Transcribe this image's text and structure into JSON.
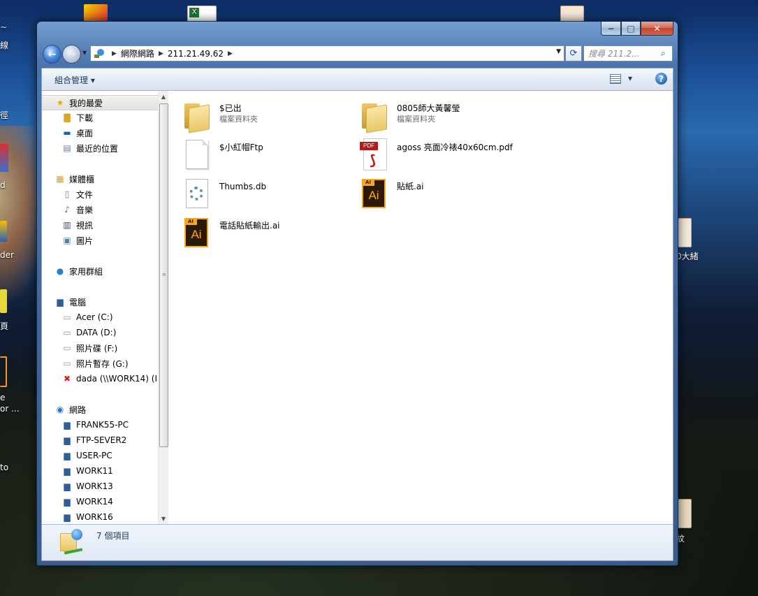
{
  "desktop": {
    "icons": [
      {
        "label": "線"
      },
      {
        "label": "徑"
      },
      {
        "label": "d"
      },
      {
        "label": "der"
      },
      {
        "label": "頁"
      },
      {
        "label": "e"
      },
      {
        "label": "or ..."
      },
      {
        "label": "to"
      },
      {
        "label": "0大緒"
      },
      {
        "label": "紋"
      }
    ]
  },
  "window": {
    "caption_buttons": {
      "minimize": "−",
      "maximize": "□",
      "close": "✕"
    },
    "address": {
      "crumbs": [
        "網際網路",
        "211.21.49.62"
      ]
    },
    "search": {
      "placeholder": "搜尋 211.2..."
    },
    "toolbar": {
      "organize": "組合管理 ▾",
      "views": "▾",
      "help": "?"
    },
    "sidebar": {
      "favorites": {
        "title": "我的最愛",
        "items": [
          "下載",
          "桌面",
          "最近的位置"
        ]
      },
      "libraries": {
        "title": "媒體櫃",
        "items": [
          "文件",
          "音樂",
          "視訊",
          "圖片"
        ]
      },
      "homegroup": {
        "title": "家用群組"
      },
      "computer": {
        "title": "電腦",
        "items": [
          "Acer (C:)",
          "DATA (D:)",
          "照片碟 (F:)",
          "照片暫存 (G:)",
          "dada (\\\\WORK14) (I"
        ]
      },
      "network": {
        "title": "網路",
        "items": [
          "FRANK55-PC",
          "FTP-SEVER2",
          "USER-PC",
          "WORK11",
          "WORK13",
          "WORK14",
          "WORK16"
        ]
      }
    },
    "files": [
      {
        "name": "$已出",
        "type": "檔案資料夾",
        "icon": "folder-icon"
      },
      {
        "name": "0805師大黃馨瑩",
        "type": "檔案資料夾",
        "icon": "folder-icon"
      },
      {
        "name": "$小紅帽Ftp",
        "type": "",
        "icon": "file-icon"
      },
      {
        "name": "agoss 亮面冷裱40x60cm.pdf",
        "type": "",
        "icon": "pdf-icon"
      },
      {
        "name": "Thumbs.db",
        "type": "",
        "icon": "db-file-icon"
      },
      {
        "name": "貼紙.ai",
        "type": "",
        "icon": "ai-icon"
      },
      {
        "name": "電話貼紙輸出.ai",
        "type": "",
        "icon": "ai-icon"
      }
    ],
    "status": {
      "count": "7 個項目"
    }
  }
}
